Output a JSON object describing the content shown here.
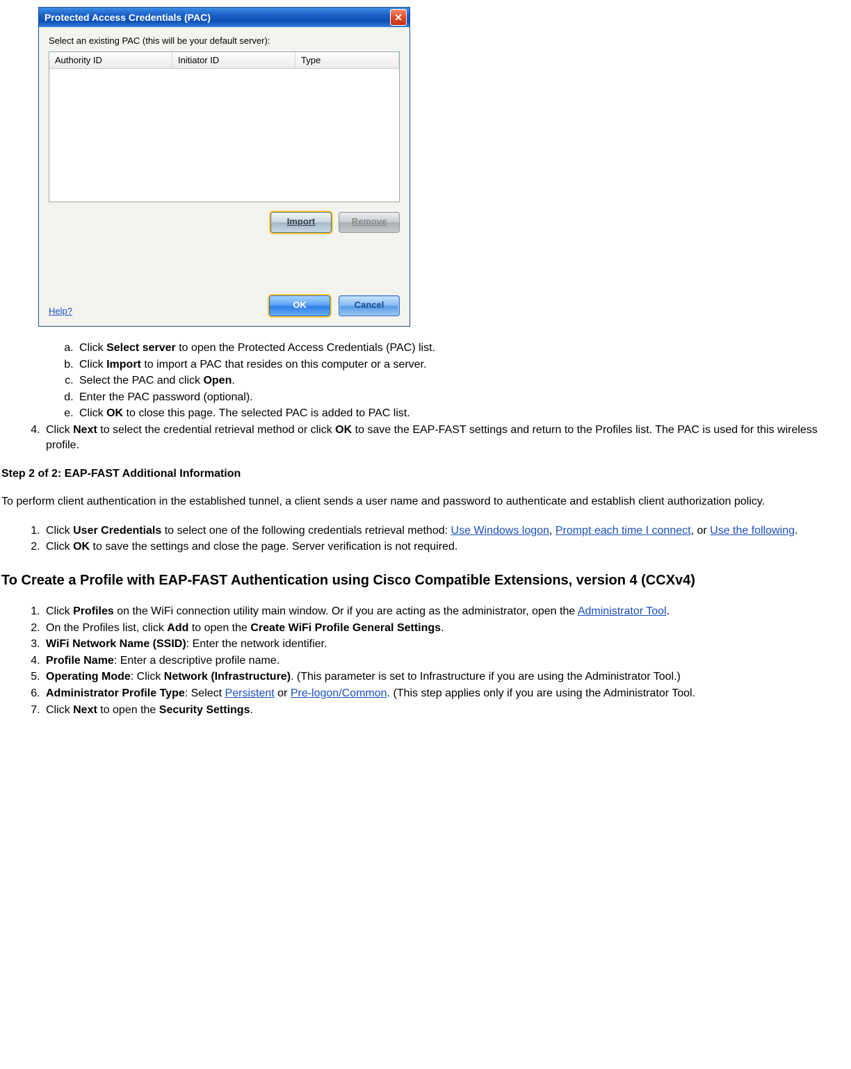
{
  "dialog": {
    "title": "Protected Access Credentials (PAC)",
    "instruction": "Select an existing PAC (this will be your default server):",
    "columns": {
      "c1": "Authority ID",
      "c2": "Initiator ID",
      "c3": "Type"
    },
    "import": "Import",
    "remove": "Remove",
    "help": "Help?",
    "ok": "OK",
    "cancel": "Cancel"
  },
  "sublistA": {
    "a_pre": "Click ",
    "a_bold": "Select server",
    "a_post": " to open the Protected Access Credentials (PAC) list.",
    "b_pre": "Click ",
    "b_bold": "Import",
    "b_post": " to import a PAC that resides on this computer or a server.",
    "c_pre": "Select the PAC and click ",
    "c_bold": "Open",
    "c_post": ".",
    "d": "Enter the PAC password (optional).",
    "e_pre": "Click ",
    "e_bold": "OK",
    "e_post": " to close this page. The selected PAC is added to PAC list."
  },
  "item4": {
    "pre": "Click ",
    "b1": "Next",
    "mid": " to select the credential retrieval method or click ",
    "b2": "OK",
    "post": " to save the EAP-FAST settings and return to the Profiles list. The PAC is used for this wireless profile."
  },
  "step2_heading": "Step 2 of 2: EAP-FAST Additional Information",
  "step2_para": "To perform client authentication in the established tunnel, a client sends a user name and password to authenticate and establish client authorization policy.",
  "step2_list": {
    "i1_pre": "Click ",
    "i1_bold": "User Credentials",
    "i1_mid": " to select one of the following credentials retrieval method: ",
    "i1_link1": "Use Windows logon",
    "i1_sep1": ", ",
    "i1_link2": "Prompt each time I connect",
    "i1_sep2": ", or ",
    "i1_link3": "Use the following",
    "i1_end": ".",
    "i2_pre": "Click ",
    "i2_bold": "OK",
    "i2_post": " to save the settings and close the page. Server verification is not required."
  },
  "section_heading": "To Create a Profile with EAP-FAST Authentication using Cisco Compatible Extensions, version 4 (CCXv4)",
  "ccx": {
    "i1_pre": "Click ",
    "i1_bold": "Profiles",
    "i1_mid": " on the WiFi connection utility main window. Or if you are acting as the administrator, open the ",
    "i1_link": "Administrator Tool",
    "i1_end": ".",
    "i2_pre": "On the Profiles list, click ",
    "i2_b1": "Add",
    "i2_mid": " to open the ",
    "i2_b2": "Create WiFi Profile General Settings",
    "i2_end": ".",
    "i3_b": "WiFi Network Name (SSID)",
    "i3_post": ": Enter the network identifier.",
    "i4_b": "Profile Name",
    "i4_post": ": Enter a descriptive profile name.",
    "i5_b1": "Operating Mode",
    "i5_mid": ": Click ",
    "i5_b2": "Network (Infrastructure)",
    "i5_post": ". (This parameter is set to Infrastructure if you are using the Administrator Tool.)",
    "i6_b": "Administrator Profile Type",
    "i6_mid": ": Select ",
    "i6_link1": "Persistent",
    "i6_or": " or ",
    "i6_link2": "Pre-logon/Common",
    "i6_post": ". (This step applies only if you are using the Administrator Tool.",
    "i7_pre": "Click ",
    "i7_b1": "Next",
    "i7_mid": " to open the ",
    "i7_b2": "Security Settings",
    "i7_end": "."
  }
}
